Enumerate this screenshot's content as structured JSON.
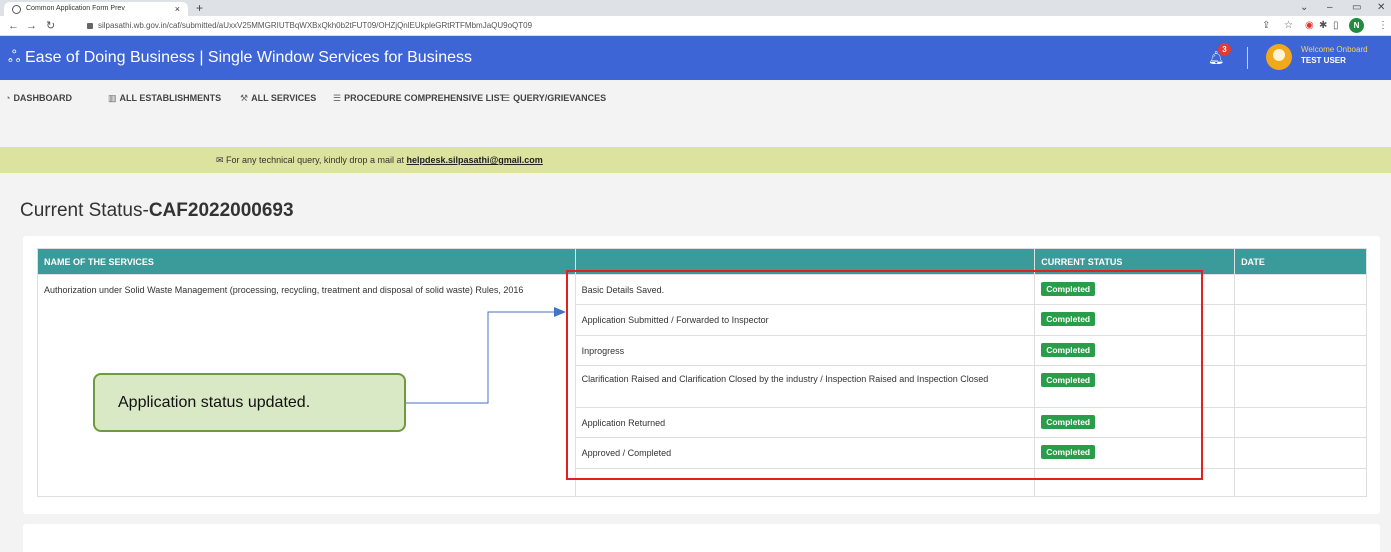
{
  "browser": {
    "tab_title": "Common Application Form Prev",
    "tab_close": "×",
    "new_tab": "+",
    "url": "silpasathi.wb.gov.in/caf/submitted/aUxxV25MMGRIUTBqWXBxQkh0b2tFUT09/OHZjQnlEUkpleGRtRTFMbmJaQU9oQT09",
    "profile_initial": "N"
  },
  "header": {
    "title": "Ease of Doing Business | Single Window Services for Business",
    "notifications": "3",
    "welcome": "Welcome Onboard",
    "user": "TEST USER"
  },
  "nav": {
    "items": [
      {
        "label": "DASHBOARD",
        "icon": "dashboard-icon"
      },
      {
        "label": "ALL ESTABLISHMENTS",
        "icon": "building-icon"
      },
      {
        "label": "ALL SERVICES",
        "icon": "wrench-icon"
      },
      {
        "label": "PROCEDURE COMPREHENSIVE LIST",
        "icon": "list-icon"
      },
      {
        "label": "QUERY/GRIEVANCES",
        "icon": "list-icon"
      }
    ]
  },
  "notice": {
    "text": "For any technical query, kindly drop a mail at",
    "email": "helpdesk.silpasathi@gmail.com"
  },
  "page": {
    "heading_prefix": "Current Status-",
    "heading_id": "CAF2022000693"
  },
  "table": {
    "headers": [
      "NAME OF THE SERVICES",
      "",
      "CURRENT STATUS",
      "DATE"
    ],
    "service": "Authorization under Solid Waste Management (processing, recycling, treatment and disposal of solid waste) Rules, 2016",
    "steps": [
      {
        "label": "Basic Details Saved.",
        "status": "Completed",
        "date": ""
      },
      {
        "label": "Application Submitted / Forwarded to Inspector",
        "status": "Completed",
        "date": ""
      },
      {
        "label": "Inprogress",
        "status": "Completed",
        "date": ""
      },
      {
        "label": "Clarification Raised and Clarification Closed by the industry / Inspection Raised and Inspection Closed",
        "status": "Completed",
        "date": ""
      },
      {
        "label": "Application Returned",
        "status": "Completed",
        "date": ""
      },
      {
        "label": "Approved / Completed",
        "status": "Completed",
        "date": ""
      }
    ]
  },
  "annotation": {
    "callout": "Application status updated."
  },
  "colors": {
    "header_bg": "#3d65d6",
    "table_header": "#3a9b9a",
    "badge": "#2a9d4a",
    "notice_bg": "#dce39f",
    "highlight": "#e32020"
  }
}
